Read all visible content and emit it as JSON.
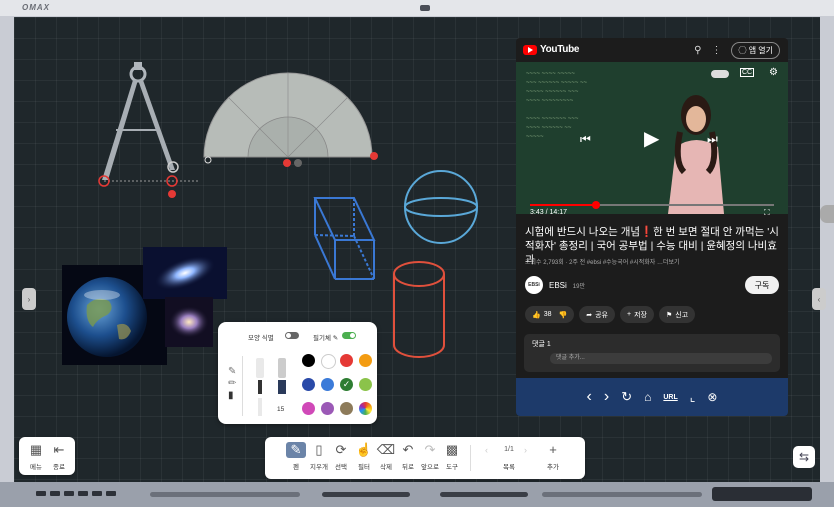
{
  "device": {
    "brand": "OMAX"
  },
  "youtube": {
    "logo_text": "YouTube",
    "open_app_label": "앱 열기",
    "cc_label": "CC",
    "time_current": "3:43",
    "time_total": "14:17",
    "progress": 0.27,
    "title": "시험에 반드시 나오는 개념❗한 번 보면 절대 안 까먹는 '시적화자' 총정리 | 국어 공부법 | 수능 대비 | 윤혜정의 나비효과",
    "meta": "조회수 2,793회 · 2주 전   #ebsi #수능국어 #시적화자 …더보기",
    "channel_avatar": "EBSi",
    "channel_name": "EBSi",
    "channel_subs": "19만",
    "subscribe_label": "구독",
    "like_count": "38",
    "share_label": "공유",
    "save_label": "저장",
    "report_label": "신고",
    "comments_title": "댓글 1",
    "comment_placeholder": "댓글 추가...",
    "nav_icons": [
      "back-icon",
      "forward-icon",
      "refresh-icon",
      "home-icon",
      "url-icon",
      "crop-icon",
      "close-icon"
    ],
    "url_label": "URL"
  },
  "palette": {
    "shape_recognition_label": "모양 식별",
    "pen_pressure_label": "필기체 ✎",
    "shape_recognition_on": false,
    "pen_pressure_on": true,
    "size_value": "15",
    "colors": [
      "#000000",
      "#ffffff",
      "#e53935",
      "#f39c12",
      "#2a4aa8",
      "#3b7bd9",
      "#2e7d32",
      "#8bc34a",
      "#d049b8",
      "#9b59b6",
      "#8d7b5a",
      "rainbow"
    ],
    "selected_color": "#2e7d32"
  },
  "menu_toolbar": {
    "menu_label": "메뉴",
    "exit_label": "종료"
  },
  "main_toolbar": {
    "pen_label": "펜",
    "eraser_label": "지우개",
    "select_label": "선택",
    "touch_label": "필터",
    "clear_label": "삭제",
    "undo_label": "뒤로",
    "redo_label": "앞으로",
    "tools_label": "도구",
    "page_indicator": "1/1",
    "page_list_label": "목록",
    "add_label": "추가"
  }
}
